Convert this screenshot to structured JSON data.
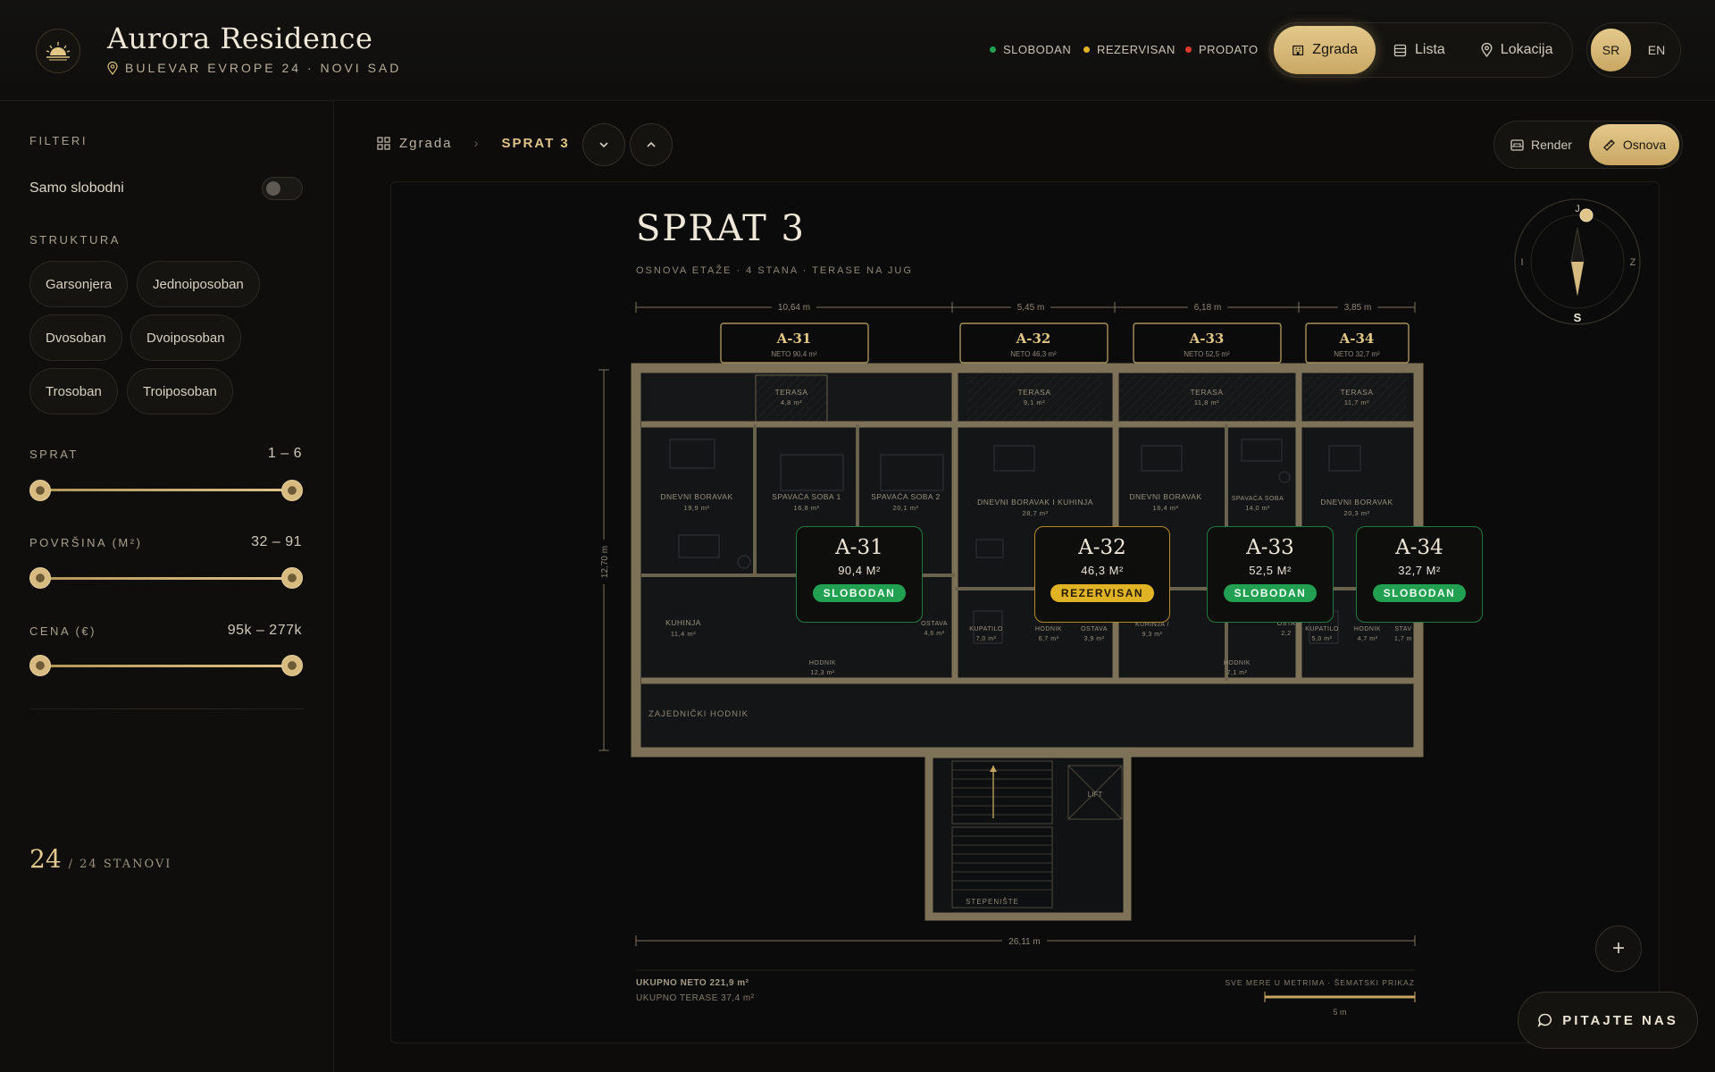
{
  "brand": {
    "title": "Aurora Residence",
    "address": "BULEVAR EVROPE 24 · NOVI SAD",
    "logo_icon": "sunrise-icon"
  },
  "legend": [
    {
      "label": "SLOBODAN",
      "color": "#22a052"
    },
    {
      "label": "REZERVISAN",
      "color": "#e0b325"
    },
    {
      "label": "PRODATO",
      "color": "#d8392f"
    }
  ],
  "view_tabs": [
    {
      "label": "Zgrada",
      "icon": "building-icon",
      "active": true
    },
    {
      "label": "Lista",
      "icon": "list-icon",
      "active": false
    },
    {
      "label": "Lokacija",
      "icon": "location-pin-icon",
      "active": false
    }
  ],
  "languages": [
    {
      "label": "SR",
      "active": true
    },
    {
      "label": "EN",
      "active": false
    }
  ],
  "sidebar": {
    "filters_title": "FILTERI",
    "only_free_label": "Samo slobodni",
    "only_free_on": false,
    "structure_title": "STRUKTURA",
    "structures": [
      "Garsonjera",
      "Jednoiposoban",
      "Dvosoban",
      "Dvoiposoban",
      "Trosoban",
      "Troiposoban"
    ],
    "ranges": [
      {
        "label": "SPRAT",
        "value": "1 – 6"
      },
      {
        "label": "POVRŠINA (M²)",
        "value": "32 – 91"
      },
      {
        "label": "CENA (€)",
        "value": "95k – 277k"
      }
    ],
    "count": "24",
    "count_total": "/ 24 STANOVI"
  },
  "breadcrumb": {
    "root": "Zgrada",
    "current": "SPRAT 3"
  },
  "modes": [
    {
      "label": "Render",
      "icon": "image-icon",
      "active": false
    },
    {
      "label": "Osnova",
      "icon": "ruler-icon",
      "active": true
    }
  ],
  "plan": {
    "title": "SPRAT 3",
    "subtitle": "OSNOVA ETAŽE · 4 STANA · TERASE NA JUG",
    "dims_top": [
      "10,64 m",
      "5,45 m",
      "6,18 m",
      "3,85 m"
    ],
    "dim_height": "12,70 m",
    "dim_bottom": "26,11 m",
    "apartments": [
      {
        "name": "A-31",
        "net": "NETO 90,4 m²",
        "area": "90,4 M²",
        "status": "SLOBODAN",
        "color": "#22a052"
      },
      {
        "name": "A-32",
        "net": "NETO 46,3 m²",
        "area": "46,3 M²",
        "status": "REZERVISAN",
        "color": "#e0b325"
      },
      {
        "name": "A-33",
        "net": "NETO 52,5 m²",
        "area": "52,5 M²",
        "status": "SLOBODAN",
        "color": "#22a052"
      },
      {
        "name": "A-34",
        "net": "NETO 32,7 m²",
        "area": "32,7 M²",
        "status": "SLOBODAN",
        "color": "#22a052"
      }
    ],
    "rooms": {
      "terasa": "TERASA",
      "t1": "4,8 m²",
      "t2": "9,1 m²",
      "t3": "11,8 m²",
      "t4": "11,7 m²",
      "db1": "DNEVNI BORAVAK",
      "db1a": "19,9 m²",
      "ss1": "SPAVAĆA SOBA 1",
      "ss1a": "16,8 m²",
      "ss2": "SPAVAĆA SOBA 2",
      "ss2a": "20,1 m²",
      "dbk": "DNEVNI BORAVAK I KUHINJA",
      "dbka": "28,7 m²",
      "db3": "DNEVNI BORAVAK",
      "db3a": "16,4 m²",
      "ss3": "SPAVAĆA SOBA",
      "ss3a": "14,0 m²",
      "db4": "DNEVNI BORAVAK",
      "db4a": "20,3 m²",
      "kuh": "KUHINJA",
      "kuha": "11,4 m²",
      "ost": "OSTAVA",
      "osta": "4,6 m²",
      "hod": "HODNIK",
      "hoda": "12,3 m²",
      "kup": "KUPATILO",
      "kupa": "7,0 m²",
      "hod2": "HODNIK",
      "hod2a": "6,7 m²",
      "ost2": "OSTAVA",
      "ost2a": "3,9 m²",
      "kuh3": "KUHINJA /",
      "kuh3a": "9,3 m²",
      "hod3": "HODNIK",
      "hod3a": "7,1 m²",
      "ost3": "OSTA",
      "ost3a": "2,2",
      "kup4": "KUPATILO",
      "kup4a": "5,0 m²",
      "hod4": "HODNIK",
      "hod4a": "4,7 m²",
      "sta4": "STAV",
      "sta4a": "1,7 m",
      "corridor": "ZAJEDNIČKI HODNIK",
      "lift": "LIFT",
      "stairs": "STEPENIŠTE"
    },
    "total_net": "UKUPNO NETO 221,9 m²",
    "total_terraces": "UKUPNO TERASE 37,4 m²",
    "note": "SVE MERE U METRIMA · ŠEMATSKI PRIKAZ",
    "scale": "5 m",
    "compass": {
      "n": "J",
      "s": "S",
      "w": "I",
      "e": "Z"
    }
  },
  "ask_label": "PITAJTE NAS"
}
